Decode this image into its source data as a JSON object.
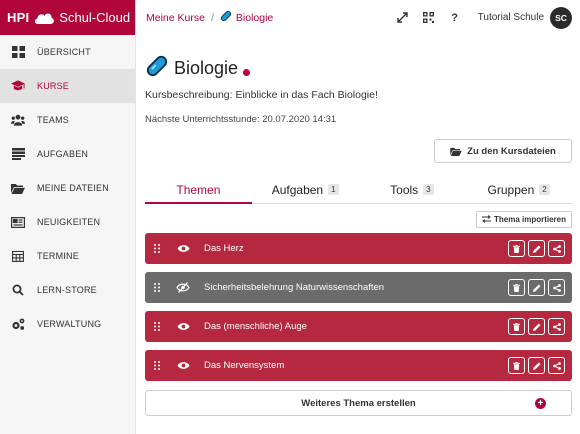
{
  "brand": {
    "hpi": "HPI",
    "name": "Schul-Cloud"
  },
  "sidebar": {
    "items": [
      {
        "label": "ÜBERSICHT",
        "icon": "dashboard-icon",
        "active": false
      },
      {
        "label": "KURSE",
        "icon": "graduation-cap-icon",
        "active": true
      },
      {
        "label": "TEAMS",
        "icon": "users-icon",
        "active": false
      },
      {
        "label": "AUFGABEN",
        "icon": "tasks-icon",
        "active": false
      },
      {
        "label": "MEINE DATEIEN",
        "icon": "folder-icon",
        "active": false
      },
      {
        "label": "NEUIGKEITEN",
        "icon": "newspaper-icon",
        "active": false
      },
      {
        "label": "TERMINE",
        "icon": "calendar-icon",
        "active": false
      },
      {
        "label": "LERN-STORE",
        "icon": "search-icon",
        "active": false
      },
      {
        "label": "VERWALTUNG",
        "icon": "cogs-icon",
        "active": false
      }
    ]
  },
  "breadcrumb": {
    "parent": "Meine Kurse",
    "separator": "/",
    "current": "Biologie"
  },
  "topbar": {
    "user_name": "Tutorial Schule",
    "avatar_initials": "SC",
    "help": "?"
  },
  "course": {
    "title": "Biologie",
    "description": "Kursbeschreibung: Einblicke in das Fach Biologie!",
    "next_lesson": "Nächste Unterrichtsstunde: 20.07.2020 14:31",
    "files_button": "Zu den Kursdateien"
  },
  "tabs": [
    {
      "label": "Themen",
      "count": null,
      "active": true
    },
    {
      "label": "Aufgaben",
      "count": "1",
      "active": false
    },
    {
      "label": "Tools",
      "count": "3",
      "active": false
    },
    {
      "label": "Gruppen",
      "count": "2",
      "active": false
    }
  ],
  "import_button": "Thema importieren",
  "topics": [
    {
      "name": "Das Herz",
      "visible": true
    },
    {
      "name": "Sicherheitsbelehrung Naturwissenschaften",
      "visible": false
    },
    {
      "name": "Das (menschliche) Auge",
      "visible": true
    },
    {
      "name": "Das Nervensystem",
      "visible": true
    }
  ],
  "create_button": "Weiteres Thema erstellen",
  "colors": {
    "brand": "#b1063a",
    "topic_red": "#b5283f",
    "topic_hidden": "#6b6b6b"
  }
}
